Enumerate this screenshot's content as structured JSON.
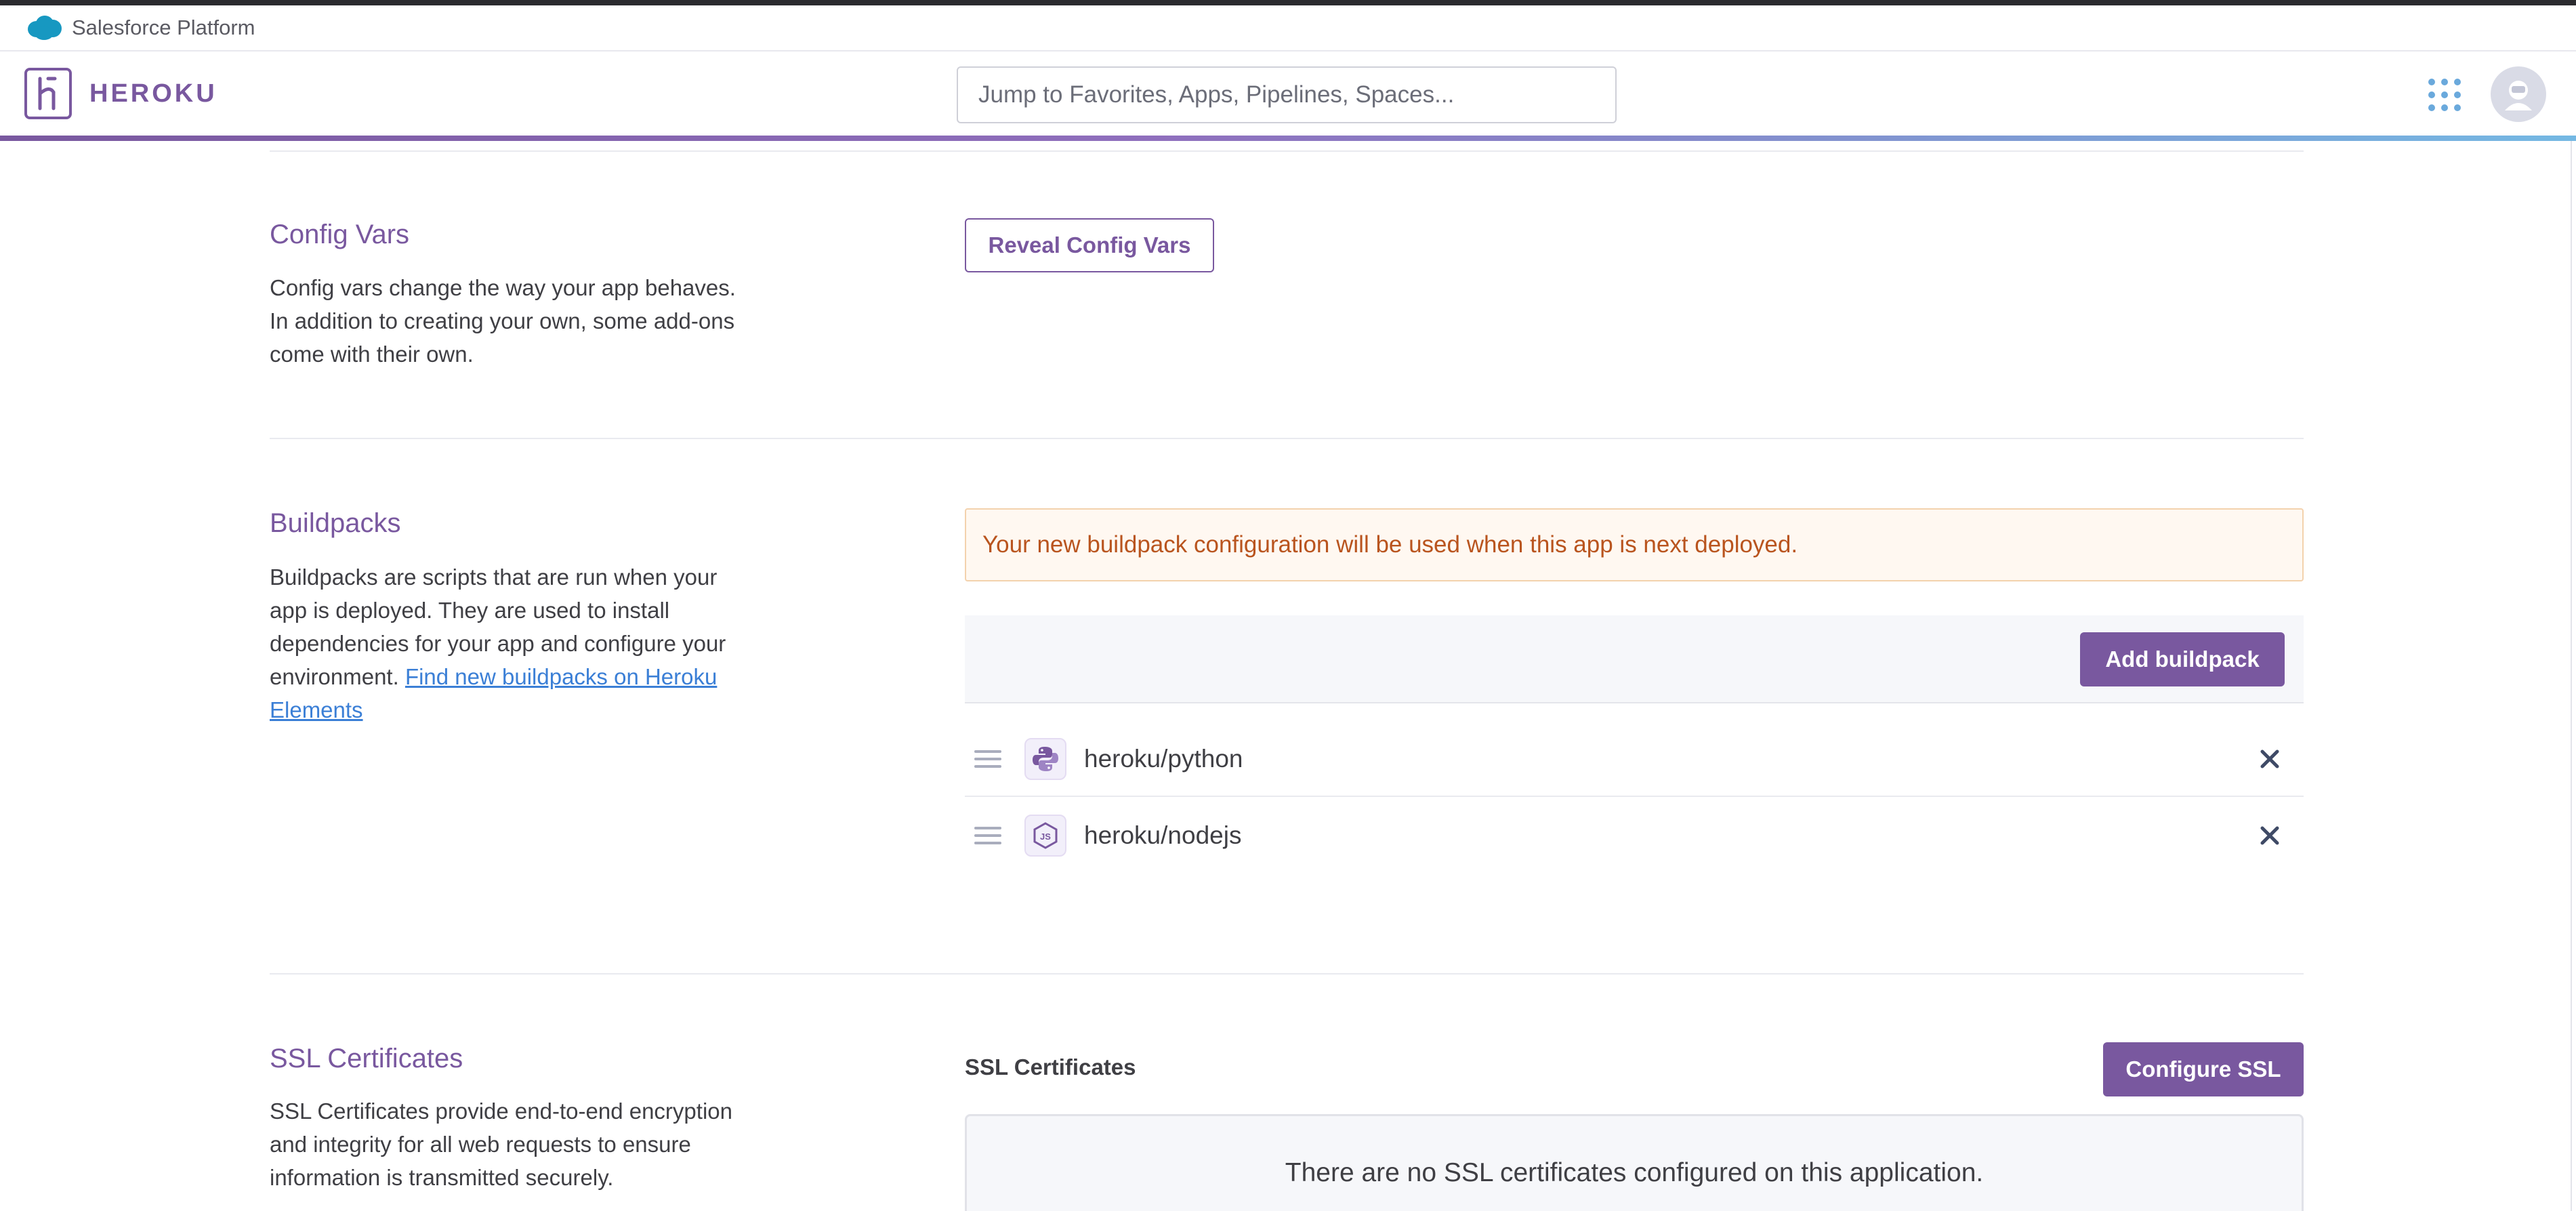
{
  "platform_bar": {
    "label": "Salesforce Platform"
  },
  "header": {
    "brand": "HEROKU",
    "search_placeholder": "Jump to Favorites, Apps, Pipelines, Spaces..."
  },
  "config_vars": {
    "title": "Config Vars",
    "description": "Config vars change the way your app behaves. In addition to creating your own, some add-ons come with their own.",
    "reveal_button": "Reveal Config Vars"
  },
  "buildpacks": {
    "title": "Buildpacks",
    "description": "Buildpacks are scripts that are run when your app is deployed. They are used to install dependencies for your app and configure your environment.",
    "link_text": "Find new buildpacks on Heroku Elements",
    "notice": "Your new buildpack configuration will be used when this app is next deployed.",
    "add_button": "Add buildpack",
    "items": [
      {
        "name": "heroku/python",
        "icon": "python-icon"
      },
      {
        "name": "heroku/nodejs",
        "icon": "nodejs-icon"
      }
    ]
  },
  "ssl": {
    "title": "SSL Certificates",
    "description": "SSL Certificates provide end-to-end encryption and integrity for all web requests to ensure information is transmitted securely.",
    "panel_label": "SSL Certificates",
    "configure_button": "Configure SSL",
    "empty_message": "There are no SSL certificates configured on this application."
  },
  "colors": {
    "brand_purple": "#79589f",
    "link_blue": "#3b7fd6",
    "notice_text": "#b9541e",
    "notice_bg": "#fff8f1"
  }
}
